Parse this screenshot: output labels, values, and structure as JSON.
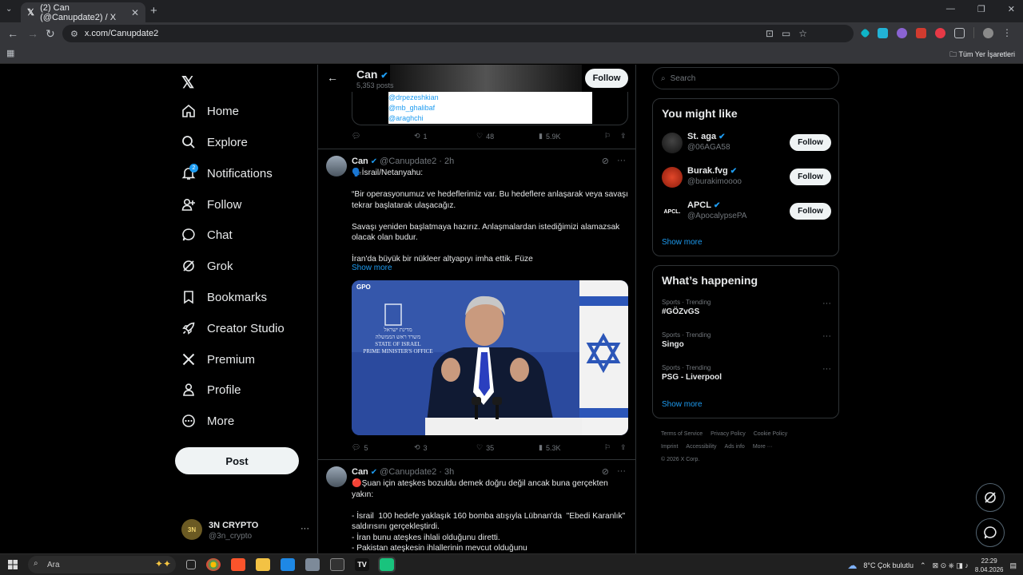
{
  "browser": {
    "tab_title": "(2) Can (@Canupdate2) / X",
    "url": "x.com/Canupdate2",
    "bookmarks_all": "Tüm Yer İşaretleri"
  },
  "nav": {
    "items": [
      {
        "label": "Home",
        "icon": "home-icon"
      },
      {
        "label": "Explore",
        "icon": "search-icon"
      },
      {
        "label": "Notifications",
        "icon": "bell-icon",
        "badge": "2"
      },
      {
        "label": "Follow",
        "icon": "person-plus-icon"
      },
      {
        "label": "Chat",
        "icon": "chat-icon"
      },
      {
        "label": "Grok",
        "icon": "grok-icon"
      },
      {
        "label": "Bookmarks",
        "icon": "bookmark-icon"
      },
      {
        "label": "Creator Studio",
        "icon": "rocket-icon"
      },
      {
        "label": "Premium",
        "icon": "x-logo-icon"
      },
      {
        "label": "Profile",
        "icon": "person-icon"
      },
      {
        "label": "More",
        "icon": "more-circle-icon"
      }
    ],
    "post_label": "Post",
    "account": {
      "name": "3N CRYPTO",
      "handle": "@3n_crypto",
      "avatar_text": "3N"
    }
  },
  "profile_header": {
    "name": "Can",
    "posts": "5,353 posts",
    "follow_label": "Follow"
  },
  "card_mentions": [
    "@drpezeshkian",
    "@mb_ghalibaf",
    "@araghchi"
  ],
  "first_actions": {
    "replies": "",
    "reposts": "1",
    "likes": "48",
    "views": "5.9K"
  },
  "tweets": [
    {
      "name": "Can",
      "handle": "@Canupdate2",
      "time": "2h",
      "text": "🗣️İsrail/Netanyahu:\n\n“Bir operasyonumuz ve hedeflerimiz var. Bu hedeflere anlaşarak veya savaşı tekrar başlatarak ulaşacağız.\n\nSavaşı yeniden başlatmaya hazırız. Anlaşmalardan istediğimizi alamazsak olacak olan budur.\n\nİran'da büyük bir nükleer altyapıyı imha ettik. Füze",
      "show_more": "Show more",
      "media_text": [
        "מדינת ישראל",
        "משרד ראש הממשלה",
        "STATE OF ISRAEL",
        "PRIME MINISTER'S OFFICE"
      ],
      "media_logo": "GPO",
      "replies": "5",
      "reposts": "3",
      "likes": "35",
      "views": "5.3K"
    },
    {
      "name": "Can",
      "handle": "@Canupdate2",
      "time": "3h",
      "text": "🔴Şuan için ateşkes bozuldu demek doğru değil ancak buna gerçekten yakın:\n\n- İsrail  100 hedefe yaklaşık 160 bomba atışıyla Lübnan'da  \"Ebedi Karanlık\" saldırısını gerçekleştirdi.\n- İran bunu ateşkes ihlali olduğunu diretti.\n- Pakistan ateşkesin ihlallerinin mevcut olduğunu"
    }
  ],
  "right": {
    "search_placeholder": "Search",
    "you_might_like": "You might like",
    "suggestions": [
      {
        "name": "St. aga",
        "handle": "@06AGA58",
        "follow": "Follow"
      },
      {
        "name": "Burak.fvg",
        "handle": "@burakimoooo",
        "follow": "Follow"
      },
      {
        "name": "APCL",
        "handle": "@ApocalypsePA",
        "follow": "Follow",
        "avatar_text": "APCL."
      }
    ],
    "show_more": "Show more",
    "whats_happening": "What’s happening",
    "trends": [
      {
        "category": "Sports · Trending",
        "title": "#GÖZvGS"
      },
      {
        "category": "Sports · Trending",
        "title": "Singo"
      },
      {
        "category": "Sports · Trending",
        "title": "PSG - Liverpool"
      }
    ],
    "footer": [
      "Terms of Service",
      "Privacy Policy",
      "Cookie Policy",
      "Imprint",
      "Accessibility",
      "Ads info",
      "More ···",
      "© 2026 X Corp."
    ]
  },
  "taskbar": {
    "search": "Ara",
    "weather": "8°C  Çok bulutlu",
    "time": "22:29",
    "date": "8.04.2026"
  },
  "colors": {
    "accent": "#1d9bf0",
    "bg": "#000000",
    "border": "#2f3336",
    "muted": "#71767b"
  }
}
